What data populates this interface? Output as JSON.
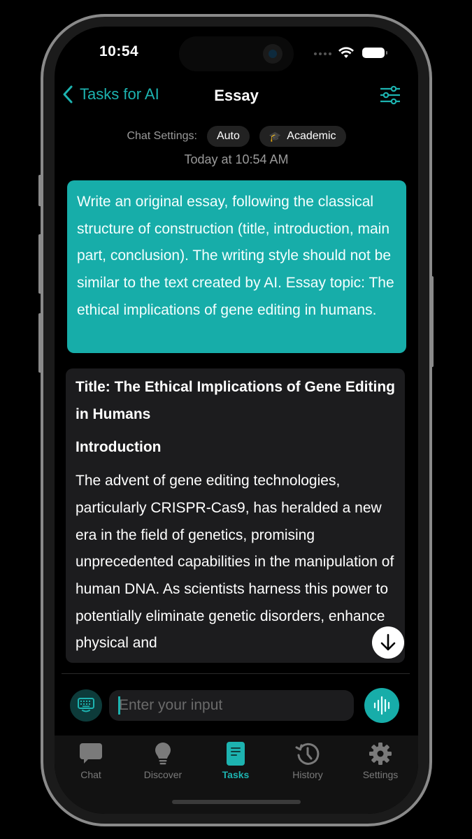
{
  "status_bar": {
    "time": "10:54"
  },
  "nav": {
    "back_label": "Tasks for AI",
    "title": "Essay",
    "filter_icon": "sliders-icon"
  },
  "chat_settings": {
    "label": "Chat Settings:",
    "chips": [
      {
        "label": "Auto"
      },
      {
        "label": "Academic",
        "icon": "graduation-cap-icon",
        "glyph": "🎓"
      }
    ],
    "timestamp": "Today at 10:54 AM"
  },
  "messages": {
    "user": {
      "text": "Write an original essay, following the classical structure of construction (title, introduction, main part, conclusion). The writing style should not be similar to the text created by AI. Essay topic: The ethical implications of gene editing in humans."
    },
    "ai": {
      "title": "Title: The Ethical Implications of Gene Editing in Humans",
      "heading": "Introduction",
      "paragraph": "The advent of gene editing technologies, particularly CRISPR-Cas9, has heralded a new era in the field of genetics, promising unprecedented capabilities in the manipulation of human DNA. As scientists harness this power to potentially eliminate genetic disorders, enhance physical and"
    }
  },
  "composer": {
    "placeholder": "Enter your input",
    "value": ""
  },
  "tabs": [
    {
      "label": "Chat",
      "icon": "chat-bubble-icon",
      "active": false
    },
    {
      "label": "Discover",
      "icon": "lightbulb-icon",
      "active": false
    },
    {
      "label": "Tasks",
      "icon": "document-icon",
      "active": true
    },
    {
      "label": "History",
      "icon": "history-clock-icon",
      "active": false
    },
    {
      "label": "Settings",
      "icon": "gear-icon",
      "active": false
    }
  ],
  "colors": {
    "accent": "#1db3b0",
    "user_bubble": "#17ada9",
    "ai_bubble": "#1c1c1e",
    "background": "#000000",
    "inactive_tab": "#7a7a7a"
  }
}
